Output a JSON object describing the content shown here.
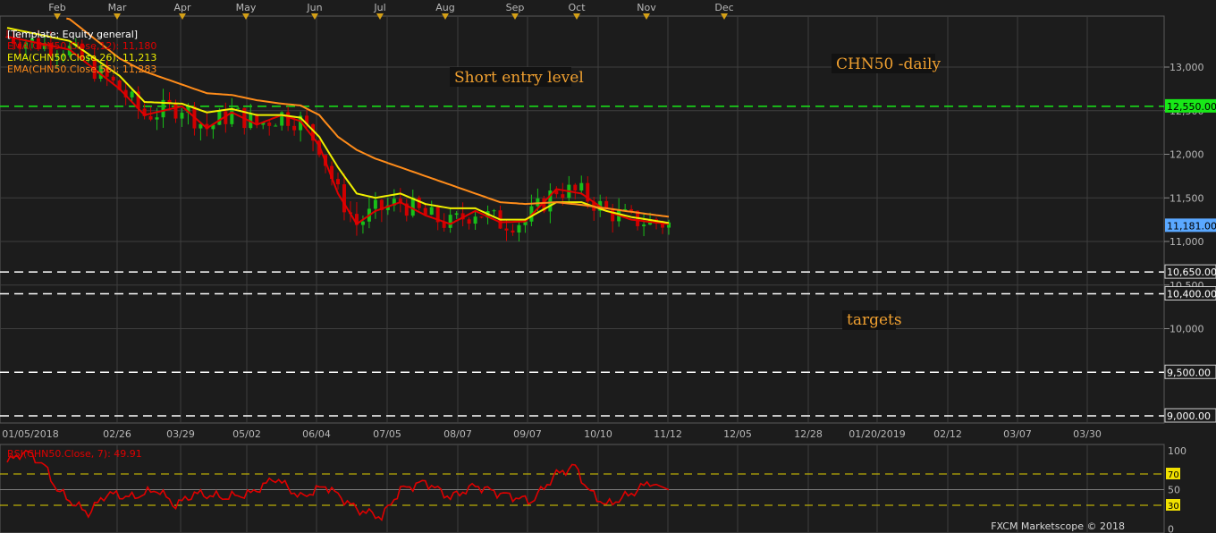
{
  "chart_data": [
    {
      "type": "candlestick",
      "title": "CHN50 -daily",
      "template": "[Template: Equity general]",
      "month_labels": [
        "Feb",
        "Mar",
        "Apr",
        "May",
        "Jun",
        "Jul",
        "Aug",
        "Sep",
        "Oct",
        "Nov",
        "Dec"
      ],
      "x_tick_labels": [
        "01/05/2018",
        "02/26",
        "03/29",
        "05/02",
        "06/04",
        "07/05",
        "08/07",
        "09/07",
        "10/10",
        "11/12",
        "12/05",
        "12/28",
        "01/20/2019",
        "02/12",
        "03/07",
        "03/30"
      ],
      "y_tick_labels": [
        "13,000",
        "12,500",
        "12,000",
        "11,500",
        "11,000",
        "10,500",
        "10,000"
      ],
      "ylim": [
        8800,
        13500
      ],
      "legend": [
        {
          "name": "EMA(CHN50.Close,12): 11,180",
          "color": "#e00000"
        },
        {
          "name": "EMA(CHN50.Close,26): 11,213",
          "color": "#f0f000"
        },
        {
          "name": "EMA(CHN50.Close,56): 11,283",
          "color": "#ff8c1a"
        }
      ],
      "series_anchors": {
        "ema12": [
          [
            0,
            13350
          ],
          [
            10,
            13200
          ],
          [
            18,
            12750
          ],
          [
            22,
            12450
          ],
          [
            28,
            12550
          ],
          [
            32,
            12300
          ],
          [
            36,
            12480
          ],
          [
            40,
            12340
          ],
          [
            44,
            12450
          ],
          [
            47,
            12380
          ],
          [
            50,
            12100
          ],
          [
            53,
            11550
          ],
          [
            56,
            11200
          ],
          [
            59,
            11350
          ],
          [
            63,
            11450
          ],
          [
            67,
            11300
          ],
          [
            71,
            11200
          ],
          [
            75,
            11350
          ],
          [
            79,
            11220
          ],
          [
            83,
            11230
          ],
          [
            88,
            11600
          ],
          [
            92,
            11550
          ],
          [
            96,
            11350
          ],
          [
            100,
            11250
          ],
          [
            106,
            11200
          ]
        ],
        "ema26": [
          [
            0,
            13450
          ],
          [
            10,
            13300
          ],
          [
            18,
            12900
          ],
          [
            22,
            12600
          ],
          [
            28,
            12580
          ],
          [
            32,
            12480
          ],
          [
            36,
            12520
          ],
          [
            40,
            12450
          ],
          [
            44,
            12450
          ],
          [
            47,
            12420
          ],
          [
            50,
            12200
          ],
          [
            53,
            11850
          ],
          [
            56,
            11550
          ],
          [
            59,
            11500
          ],
          [
            63,
            11550
          ],
          [
            67,
            11430
          ],
          [
            71,
            11380
          ],
          [
            75,
            11380
          ],
          [
            79,
            11250
          ],
          [
            83,
            11250
          ],
          [
            88,
            11450
          ],
          [
            92,
            11450
          ],
          [
            96,
            11350
          ],
          [
            100,
            11280
          ],
          [
            106,
            11213
          ]
        ],
        "ema56": [
          [
            0,
            13700
          ],
          [
            10,
            13550
          ],
          [
            18,
            13100
          ],
          [
            22,
            12950
          ],
          [
            28,
            12800
          ],
          [
            32,
            12700
          ],
          [
            36,
            12680
          ],
          [
            40,
            12620
          ],
          [
            44,
            12580
          ],
          [
            47,
            12560
          ],
          [
            50,
            12450
          ],
          [
            53,
            12200
          ],
          [
            56,
            12050
          ],
          [
            59,
            11950
          ],
          [
            63,
            11850
          ],
          [
            67,
            11750
          ],
          [
            71,
            11650
          ],
          [
            75,
            11550
          ],
          [
            79,
            11450
          ],
          [
            83,
            11430
          ],
          [
            88,
            11450
          ],
          [
            92,
            11420
          ],
          [
            96,
            11380
          ],
          [
            100,
            11340
          ],
          [
            106,
            11283
          ]
        ]
      },
      "candle_count": 107
    },
    {
      "type": "line",
      "name": "RSI(CHN50.Close, 7): 49.91",
      "y_tick_labels": [
        "100",
        "70",
        "50",
        "30",
        "0"
      ],
      "ylim": [
        0,
        100
      ],
      "levels": [
        70,
        50,
        30
      ],
      "anchors": [
        [
          0,
          85
        ],
        [
          3,
          100
        ],
        [
          6,
          80
        ],
        [
          8,
          50
        ],
        [
          11,
          30
        ],
        [
          13,
          20
        ],
        [
          16,
          45
        ],
        [
          20,
          40
        ],
        [
          24,
          50
        ],
        [
          27,
          30
        ],
        [
          30,
          45
        ],
        [
          35,
          40
        ],
        [
          39,
          45
        ],
        [
          43,
          65
        ],
        [
          47,
          40
        ],
        [
          51,
          55
        ],
        [
          56,
          25
        ],
        [
          60,
          15
        ],
        [
          63,
          50
        ],
        [
          67,
          60
        ],
        [
          71,
          40
        ],
        [
          75,
          55
        ],
        [
          79,
          45
        ],
        [
          84,
          35
        ],
        [
          88,
          70
        ],
        [
          91,
          80
        ],
        [
          93,
          50
        ],
        [
          96,
          30
        ],
        [
          100,
          45
        ],
        [
          103,
          60
        ],
        [
          106,
          49.91
        ]
      ]
    }
  ],
  "levels": [
    {
      "value": 12550,
      "label": "12,550.00",
      "color": "#18e818",
      "style": "green"
    },
    {
      "value": 10650,
      "label": "10,650.00",
      "color": "#ffffff",
      "style": "white"
    },
    {
      "value": 10400,
      "label": "10,400.00",
      "color": "#ffffff",
      "style": "white"
    },
    {
      "value": 9500,
      "label": "9,500.00",
      "color": "#ffffff",
      "style": "white"
    },
    {
      "value": 9000,
      "label": "9,000.00",
      "color": "#ffffff",
      "style": "white"
    }
  ],
  "last_price": {
    "value": 11181,
    "label": "11,181.00",
    "color": "#5aa8ff"
  },
  "annotations": {
    "entry": "Short entry level",
    "symbol": "CHN50 -daily",
    "targets": "targets"
  },
  "footer": "FXCM Marketscope © 2018",
  "colors": {
    "bg": "#1c1c1c",
    "grid": "#3e3e3e",
    "up": "#18c018",
    "down": "#d00000",
    "marker": "#d4a017"
  }
}
